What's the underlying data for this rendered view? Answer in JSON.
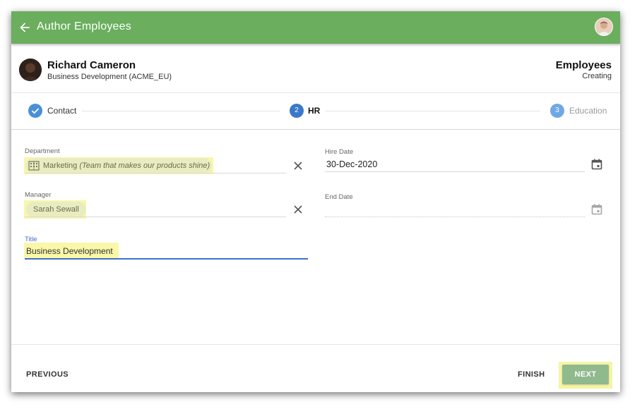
{
  "appbar": {
    "title": "Author Employees"
  },
  "record": {
    "name": "Richard Cameron",
    "subtitle": "Business Development (ACME_EU)",
    "entity": "Employees",
    "status": "Creating"
  },
  "stepper": {
    "steps": [
      {
        "number": "1",
        "label": "Contact",
        "state": "completed"
      },
      {
        "number": "2",
        "label": "HR",
        "state": "active"
      },
      {
        "number": "3",
        "label": "Education",
        "state": "upcoming"
      }
    ]
  },
  "form": {
    "department": {
      "label": "Department",
      "value": "Marketing",
      "description": "(Team that makes our products shine)"
    },
    "manager": {
      "label": "Manager",
      "value": "Sarah Sewall"
    },
    "title": {
      "label": "Title",
      "value": "Business Development"
    },
    "hire_date": {
      "label": "Hire Date",
      "value": "30-Dec-2020"
    },
    "end_date": {
      "label": "End Date",
      "value": ""
    }
  },
  "footer": {
    "previous_label": "PREVIOUS",
    "finish_label": "FINISH",
    "next_label": "NEXT"
  },
  "colors": {
    "appbar": "#6aae5e",
    "step_completed": "#4a90d9",
    "step_active": "#3a78c9",
    "step_upcoming": "#6fa8e6",
    "highlight": "#f9f7a8",
    "next_button": "#90b98e",
    "focused_underline": "#3f6fd0"
  },
  "icons": {
    "back": "arrow-left-icon",
    "check": "check-icon",
    "department": "office-building-icon",
    "clear": "close-icon",
    "calendar": "calendar-icon"
  }
}
